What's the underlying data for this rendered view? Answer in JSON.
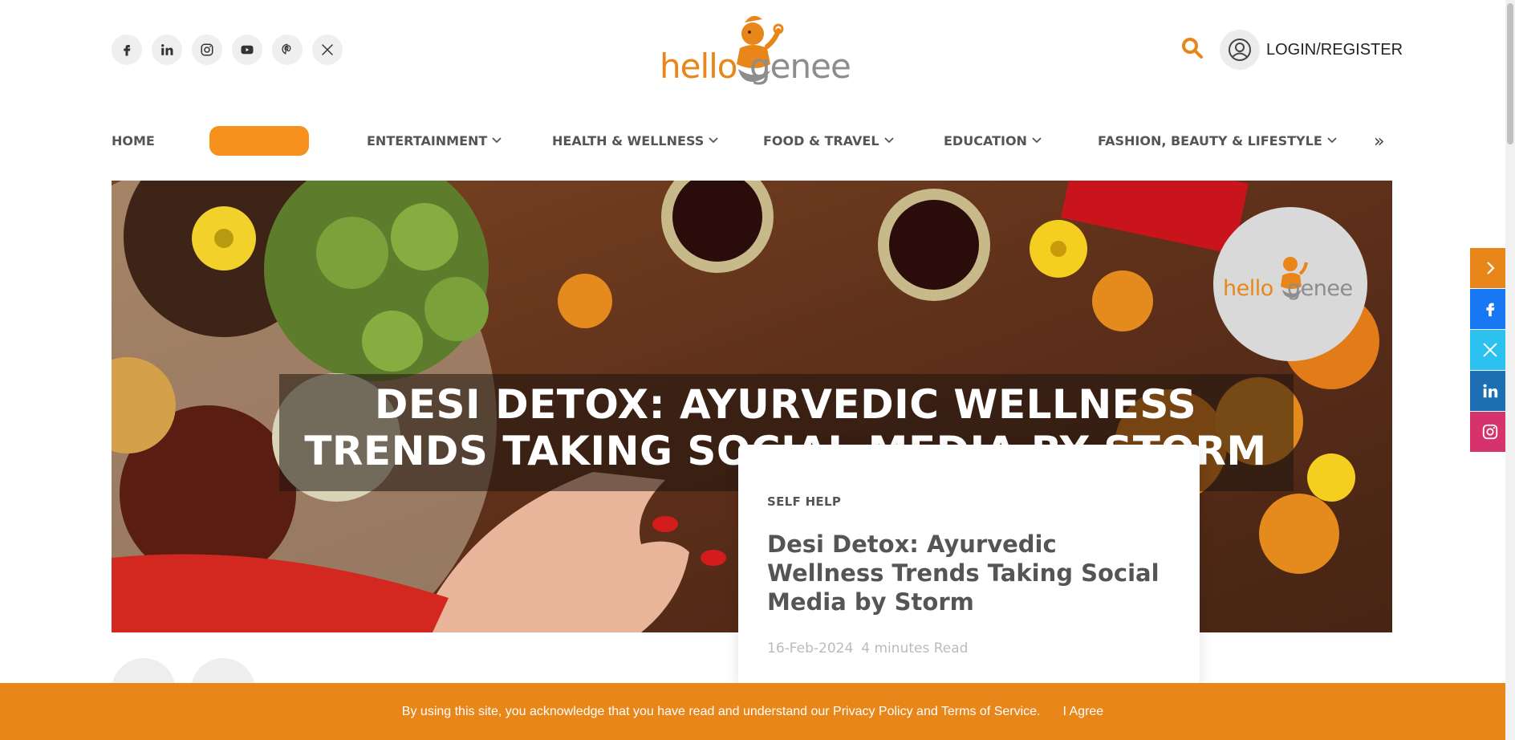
{
  "header": {
    "social": [
      {
        "name": "facebook",
        "icon": "facebook-icon"
      },
      {
        "name": "linkedin",
        "icon": "linkedin-icon"
      },
      {
        "name": "instagram",
        "icon": "instagram-icon"
      },
      {
        "name": "youtube",
        "icon": "youtube-icon"
      },
      {
        "name": "pinterest",
        "icon": "pinterest-icon"
      },
      {
        "name": "x",
        "icon": "x-icon"
      }
    ],
    "logo_left": "hello",
    "logo_right": "genee",
    "login_label": "LOGIN/REGISTER"
  },
  "nav": {
    "items": [
      "HOME",
      "ENTERTAINMENT",
      "HEALTH & WELLNESS",
      "FOOD & TRAVEL",
      "EDUCATION",
      "FASHION, BEAUTY & LIFESTYLE"
    ],
    "more": "»"
  },
  "hero": {
    "headline_line1": "DESI DETOX: AYURVEDIC WELLNESS",
    "headline_line2": "TRENDS TAKING SOCIAL MEDIA BY STORM",
    "badge_left": "hello",
    "badge_right": "genee"
  },
  "article": {
    "category": "SELF HELP",
    "title": "Desi Detox: Ayurvedic Wellness Trends Taking Social Media by Storm",
    "date": "16-Feb-2024",
    "read_time": "4 minutes Read"
  },
  "slider": {
    "prev": "‹",
    "next": "›"
  },
  "share": [
    {
      "name": "toggle",
      "icon": "chevron-right-icon",
      "color": "#e8861a"
    },
    {
      "name": "facebook",
      "icon": "facebook-icon",
      "color": "#1877f2"
    },
    {
      "name": "x",
      "icon": "x-icon",
      "color": "#2bc2f0"
    },
    {
      "name": "linkedin",
      "icon": "linkedin-icon",
      "color": "#1b6fb2"
    },
    {
      "name": "instagram",
      "icon": "instagram-icon",
      "color": "#d6336c"
    }
  ],
  "cookie": {
    "message": "By using this site, you acknowledge that you have read and understand our Privacy Policy and Terms of Service.",
    "agree": "I Agree"
  },
  "colors": {
    "brand": "#e8861a",
    "nav_pill": "#f7911e",
    "text": "#555555"
  }
}
